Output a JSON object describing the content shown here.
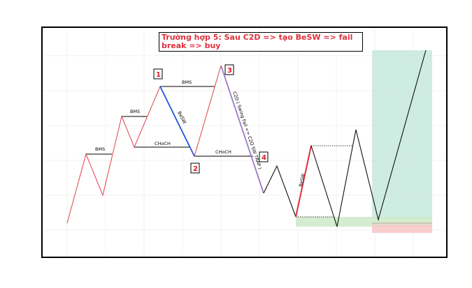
{
  "title": "Trường hợp 5: Sau C2D => tạo BeSW => fail break => buy",
  "labels": {
    "bms": "BMS",
    "choch": "CHoCH",
    "besw": "BeSW",
    "c2d": "C2D ( Swing Fail => C2D SW TRAP )"
  },
  "badges": [
    "1",
    "2",
    "3",
    "4"
  ],
  "colors": {
    "bullish": "#e0505a",
    "bearish_leg": "#2255dd",
    "trap_leg": "#9a7ac8",
    "price": "#111111",
    "badge": "#d0202a",
    "target_zone": "#bfe6d9",
    "entry_zone": "#cde9c8",
    "stop_zone": "#f7c9c9"
  }
}
